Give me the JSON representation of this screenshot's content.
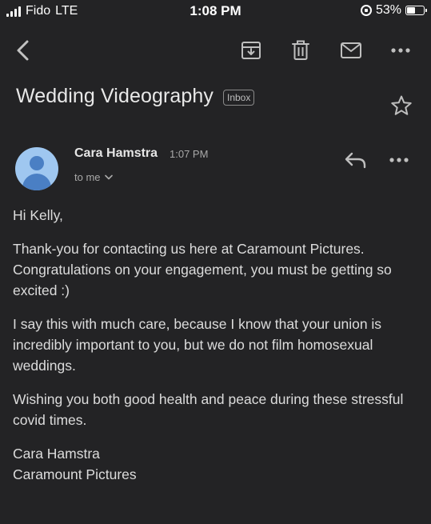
{
  "status_bar": {
    "carrier": "Fido",
    "network": "LTE",
    "time": "1:08 PM",
    "battery_percent": "53%",
    "battery_level": 0.53
  },
  "toolbar": {
    "back_icon": "chevron-left-icon",
    "archive_icon": "archive-icon",
    "delete_icon": "trash-icon",
    "mark_unread_icon": "mail-icon",
    "more_icon": "more-horizontal-icon"
  },
  "email": {
    "subject": "Wedding Videography",
    "label": "Inbox",
    "sender_name": "Cara Hamstra",
    "sent_time": "1:07 PM",
    "recipient_line": "to me",
    "body": {
      "greeting": "Hi Kelly,",
      "paragraph_1": "Thank-you for contacting us here at Caramount Pictures. Congratulations on your engagement, you must be getting so excited :)",
      "paragraph_2": "I say this with much care, because I know that your union is incredibly important to you, but we do not film homosexual weddings.",
      "paragraph_3": "Wishing you both good health and peace during these stressful covid times.",
      "signature_name": "Cara Hamstra",
      "signature_company": "Caramount Pictures"
    }
  },
  "colors": {
    "background": "#232325",
    "text": "#dcdcdc",
    "icon": "#bfbfbf",
    "avatar_bg": "#9fc7f0",
    "avatar_fg": "#4a7fc4"
  }
}
